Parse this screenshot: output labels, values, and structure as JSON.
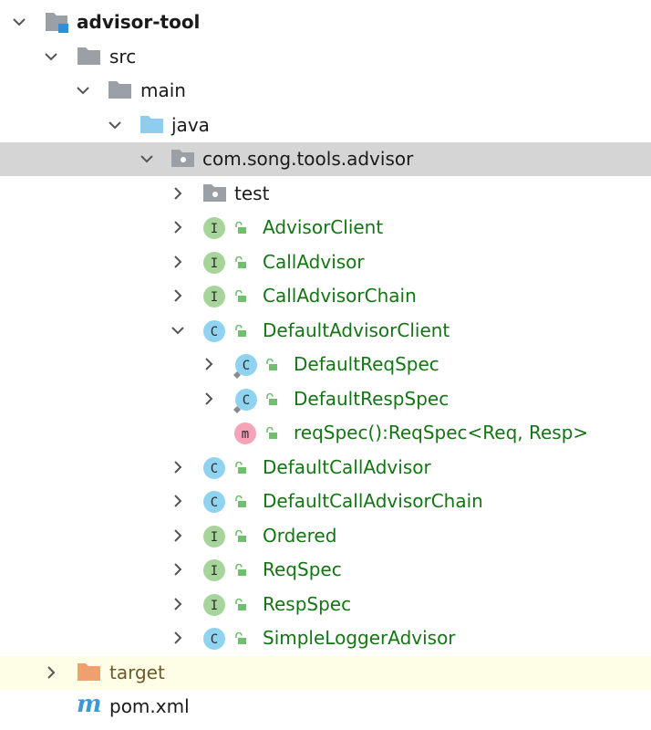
{
  "tree": {
    "root": {
      "label": "advisor-tool"
    },
    "src": {
      "label": "src"
    },
    "main": {
      "label": "main"
    },
    "java": {
      "label": "java"
    },
    "package": {
      "label": "com.song.tools.advisor"
    },
    "test": {
      "label": "test"
    },
    "items": [
      {
        "label": "AdvisorClient",
        "kind": "I"
      },
      {
        "label": "CallAdvisor",
        "kind": "I"
      },
      {
        "label": "CallAdvisorChain",
        "kind": "I"
      },
      {
        "label": "DefaultAdvisorClient",
        "kind": "C"
      },
      {
        "label": "DefaultReqSpec",
        "kind": "C"
      },
      {
        "label": "DefaultRespSpec",
        "kind": "C"
      },
      {
        "label": "reqSpec():ReqSpec<Req, Resp>",
        "kind": "m"
      },
      {
        "label": "DefaultCallAdvisor",
        "kind": "C"
      },
      {
        "label": "DefaultCallAdvisorChain",
        "kind": "C"
      },
      {
        "label": "Ordered",
        "kind": "I"
      },
      {
        "label": "ReqSpec",
        "kind": "I"
      },
      {
        "label": "RespSpec",
        "kind": "I"
      },
      {
        "label": "SimpleLoggerAdvisor",
        "kind": "C"
      }
    ],
    "target": {
      "label": "target"
    },
    "pom": {
      "label": "pom.xml",
      "icon_letter": "m"
    }
  },
  "colors": {
    "selected_row": "#d5d5d5",
    "highlight_row": "#fefde6",
    "class_green": "#137513",
    "interface_badge": "#a7d49b",
    "class_badge": "#8fd3f0",
    "method_badge": "#f5a3b8",
    "folder_gray": "#9aa0a6",
    "folder_blue": "#8ecdf0",
    "folder_orange": "#f0a070"
  }
}
